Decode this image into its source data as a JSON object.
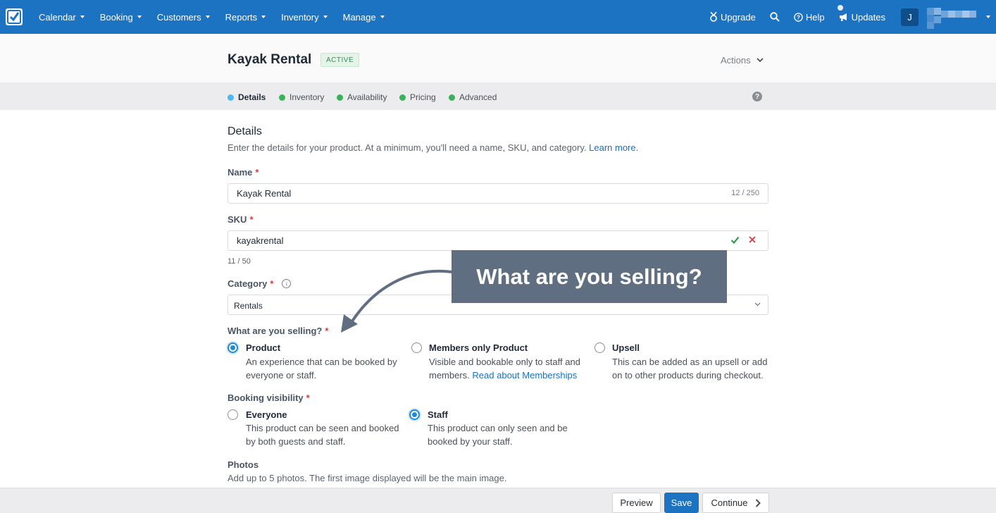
{
  "nav": {
    "menu": [
      {
        "label": "Calendar"
      },
      {
        "label": "Booking"
      },
      {
        "label": "Customers"
      },
      {
        "label": "Reports"
      },
      {
        "label": "Inventory"
      },
      {
        "label": "Manage"
      }
    ],
    "upgrade": "Upgrade",
    "help": "Help",
    "updates": "Updates",
    "avatar": "J",
    "accent": "#1b73c2"
  },
  "header": {
    "title": "Kayak Rental",
    "status": "ACTIVE",
    "actions": "Actions"
  },
  "steps": [
    {
      "label": "Details",
      "color": "#4ab8ee",
      "active": true
    },
    {
      "label": "Inventory",
      "color": "#3ab25a"
    },
    {
      "label": "Availability",
      "color": "#3ab25a"
    },
    {
      "label": "Pricing",
      "color": "#3ab25a"
    },
    {
      "label": "Advanced",
      "color": "#3ab25a"
    }
  ],
  "details": {
    "title": "Details",
    "description": "Enter the details for your product. At a minimum, you'll need a name, SKU, and category.",
    "learn_more": "Learn more",
    "learn_more_end": ".",
    "required_mark": "*"
  },
  "name_field": {
    "label": "Name",
    "value": "Kayak Rental",
    "counter": "12 / 250"
  },
  "sku_field": {
    "label": "SKU",
    "value": "kayakrental",
    "counter": "11 / 50"
  },
  "category_field": {
    "label": "Category",
    "info": "i",
    "value": "Rentals"
  },
  "selling": {
    "label": "What are you selling?",
    "options": [
      {
        "title": "Product",
        "desc1": "An experience that can be booked by",
        "desc2": "everyone or staff.",
        "checked": true
      },
      {
        "title": "Members only Product",
        "desc1": "Visible and bookable only to staff and",
        "desc2": "members.",
        "link": "Read about Memberships"
      },
      {
        "title": "Upsell",
        "desc1": "This can be added as an upsell or add",
        "desc2": "on to other products during checkout."
      }
    ]
  },
  "visibility": {
    "label": "Booking visibility",
    "options": [
      {
        "title": "Everyone",
        "desc1": "This product can be seen and booked",
        "desc2": "by both guests and staff."
      },
      {
        "title": "Staff",
        "desc1": "This product can only seen and be",
        "desc2": "booked by your staff.",
        "checked": true
      }
    ]
  },
  "photos": {
    "title": "Photos",
    "description": "Add up to 5 photos. The first image displayed will be the main image."
  },
  "callout": {
    "text": "What are you selling?"
  },
  "footer": {
    "preview": "Preview",
    "save": "Save",
    "continue": "Continue"
  }
}
